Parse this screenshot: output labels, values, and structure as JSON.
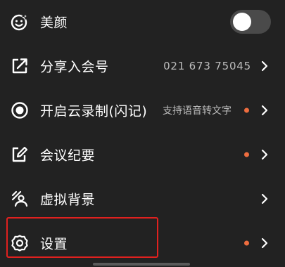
{
  "colors": {
    "background": "#222222",
    "text": "#ffffff",
    "secondary_text": "#bdbdbd",
    "badge_dot": "#ee6d3f",
    "highlight_box": "#e0211f",
    "toggle_off": "#4a4a4a"
  },
  "menu": {
    "beauty": {
      "label": "美颜",
      "icon": "smile-sparkle-icon",
      "toggle_on": false
    },
    "share_number": {
      "label": "分享入会号",
      "icon": "share-icon",
      "value": "021 673 75045"
    },
    "cloud_record": {
      "label": "开启云录制(闪记)",
      "icon": "record-icon",
      "hint": "支持语音转文字",
      "badge": true
    },
    "minutes": {
      "label": "会议纪要",
      "icon": "note-edit-icon",
      "badge": true
    },
    "virtual_bg": {
      "label": "虚拟背景",
      "icon": "virtual-background-icon"
    },
    "settings": {
      "label": "设置",
      "icon": "gear-icon",
      "badge": true,
      "highlighted": true
    }
  }
}
